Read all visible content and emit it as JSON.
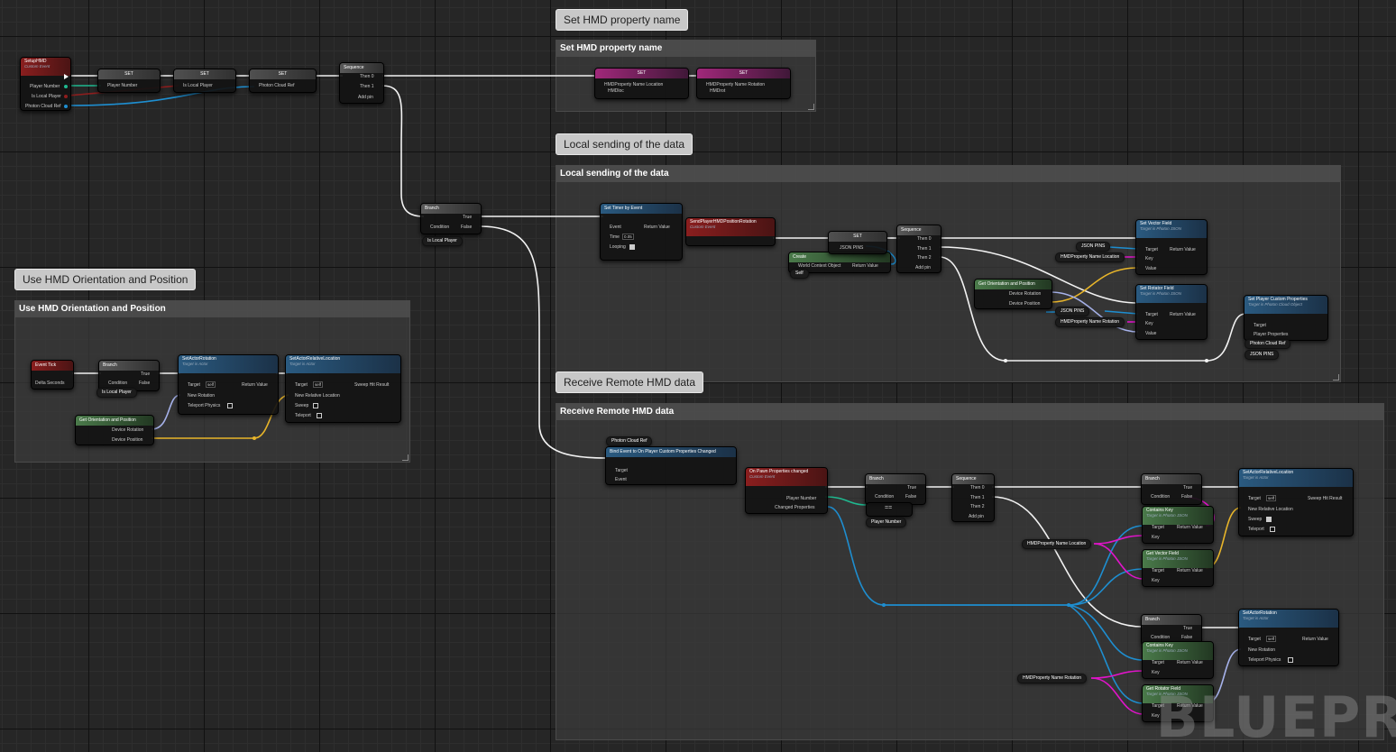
{
  "comments": {
    "set_hmd": {
      "bubble": "Set HMD property name",
      "header": "Set HMD property name"
    },
    "local_sending": {
      "bubble": "Local sending of the data",
      "header": "Local sending of the data"
    },
    "use_hmd": {
      "bubble": "Use HMD Orientation and Position",
      "header": "Use HMD Orientation and Position"
    },
    "receive": {
      "bubble": "Receive Remote HMD data",
      "header": "Receive Remote HMD data"
    }
  },
  "setup": {
    "event": "SetupHMD",
    "event_sub": "Custom Event",
    "out_player_number": "Player Number",
    "out_is_local": "Is Local Player",
    "out_photon": "Photon Cloud Ref",
    "set": "SET",
    "set1_pin": "Player Number",
    "set2_pin": "Is Local Player",
    "set3_pin": "Photon Cloud Ref",
    "sequence": "Sequence",
    "then0": "Then 0",
    "then1": "Then 1",
    "add_pin": "Add pin"
  },
  "set_hmd_nodes": {
    "set": "SET",
    "loc_pin": "HMDProperty Name Location",
    "loc_val": "HMDloc",
    "rot_pin": "HMDProperty Name Rotation",
    "rot_val": "HMDrot"
  },
  "branch_main": {
    "title": "Branch",
    "condition": "Condition",
    "true": "True",
    "false": "False",
    "is_local": "Is Local Player"
  },
  "local": {
    "timer": "Set Timer by Event",
    "event": "Event",
    "return_value": "Return Value",
    "time": "Time",
    "time_val": "0.05",
    "looping": "Looping",
    "send_event": "SendPlayerHMDPositionRotation",
    "send_sub": "Custom Event",
    "create": "Create",
    "world_ctx": "World Context Object",
    "self": "Self",
    "set": "SET",
    "json_pins": "JSON PINS",
    "sequence": "Sequence",
    "then0": "Then 0",
    "then1": "Then 1",
    "then2": "Then 2",
    "add_pin": "Add pin",
    "get_orient": "Get Orientation and Position",
    "device_rotation": "Device Rotation",
    "device_position": "Device Position",
    "set_vector": "Set Vector Field",
    "set_rotator": "Set Rotator Field",
    "target_json": "Target is Photon JSON",
    "target": "Target",
    "key": "Key",
    "value": "Value",
    "name_loc": "HMDProperty Name Location",
    "name_rot": "HMDProperty Name Rotation",
    "set_custom": "Set Player Custom Properties",
    "target_photon": "Target is Photon Cloud Object",
    "player_props": "Player Properties",
    "photon_ref": "Photon Cloud Ref"
  },
  "use": {
    "event_tick": "Event Tick",
    "delta": "Delta Seconds",
    "branch": "Branch",
    "condition": "Condition",
    "true": "True",
    "false": "False",
    "is_local": "Is Local Player",
    "set_rot": "SetActorRotation",
    "target_actor": "Target is Actor",
    "target": "Target",
    "self": "self",
    "new_rotation": "New Rotation",
    "teleport": "Teleport Physics",
    "return_value": "Return Value",
    "set_rel": "SetActorRelativeLocation",
    "new_rel": "New Relative Location",
    "sweep": "Sweep",
    "teleport2": "Teleport",
    "sweep_hit": "Sweep Hit Result",
    "get_orient": "Get Orientation and Position",
    "device_rotation": "Device Rotation",
    "device_position": "Device Position"
  },
  "receive": {
    "photon_ref": "Photon Cloud Ref",
    "bind": "Bind Event to On Player Custom Properties Changed",
    "target": "Target",
    "event": "Event",
    "pawn_event": "On Pawn Properties changed",
    "pawn_sub": "Custom Event",
    "player_number": "Player Number",
    "changed": "Changed Properties",
    "branch": "Branch",
    "condition": "Condition",
    "true": "True",
    "false": "False",
    "eq": "==",
    "sequence": "Sequence",
    "then0": "Then 0",
    "then1": "Then 1",
    "then2": "Then 2",
    "add_pin": "Add pin",
    "contains_key": "Contains Key",
    "target_json": "Target is Photon JSON",
    "key": "Key",
    "return_value": "Return Value",
    "get_vector": "Get Vector Field",
    "get_rotator": "Get Rotator Field",
    "name_loc": "HMDProperty Name Location",
    "name_rot": "HMDProperty Name Rotation",
    "set_rel": "SetActorRelativeLocation",
    "target_actor": "Target is Actor",
    "self": "self",
    "new_rel": "New Relative Location",
    "sweep": "Sweep",
    "teleport": "Teleport",
    "sweep_hit": "Sweep Hit Result",
    "set_rot": "SetActorRotation",
    "new_rotation": "New Rotation",
    "teleport_physics": "Teleport Physics"
  },
  "watermark": "BLUEPR"
}
